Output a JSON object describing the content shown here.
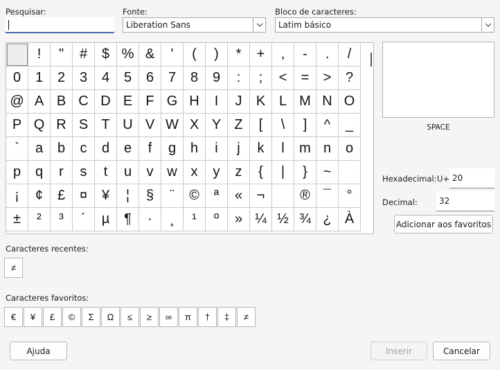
{
  "labels": {
    "search": "Pesquisar:",
    "font": "Fonte:",
    "block": "Bloco de caracteres:",
    "recent": "Caracteres recentes:",
    "favorites": "Caracteres favoritos:",
    "hex": "Hexadecimal:",
    "hex_prefix": "U+",
    "decimal": "Decimal:"
  },
  "search": {
    "value": ""
  },
  "font": {
    "value": "Liberation Sans"
  },
  "block": {
    "value": "Latim básico"
  },
  "grid": {
    "chars": [
      "",
      "!",
      "\"",
      "#",
      "$",
      "%",
      "&",
      "'",
      "(",
      ")",
      "*",
      "+",
      ",",
      "-",
      ".",
      "/",
      "0",
      "1",
      "2",
      "3",
      "4",
      "5",
      "6",
      "7",
      "8",
      "9",
      ":",
      ";",
      "<",
      "=",
      ">",
      "?",
      "@",
      "A",
      "B",
      "C",
      "D",
      "E",
      "F",
      "G",
      "H",
      "I",
      "J",
      "K",
      "L",
      "M",
      "N",
      "O",
      "P",
      "Q",
      "R",
      "S",
      "T",
      "U",
      "V",
      "W",
      "X",
      "Y",
      "Z",
      "[",
      "\\",
      "]",
      "^",
      "_",
      "`",
      "a",
      "b",
      "c",
      "d",
      "e",
      "f",
      "g",
      "h",
      "i",
      "j",
      "k",
      "l",
      "m",
      "n",
      "o",
      "p",
      "q",
      "r",
      "s",
      "t",
      "u",
      "v",
      "w",
      "x",
      "y",
      "z",
      "{",
      "|",
      "}",
      "~",
      "",
      "¡",
      "¢",
      "£",
      "¤",
      "¥",
      "¦",
      "§",
      "¨",
      "©",
      "ª",
      "«",
      "¬",
      "",
      "®",
      "¯",
      "°",
      "±",
      "²",
      "³",
      "´",
      "µ",
      "¶",
      "·",
      "¸",
      "¹",
      "º",
      "»",
      "¼",
      "½",
      "¾",
      "¿",
      "À"
    ],
    "selected_index": 0
  },
  "preview": {
    "char_name": "SPACE"
  },
  "hex_value": "20",
  "decimal_value": "32",
  "buttons": {
    "add_favorite": "Adicionar aos favoritos",
    "help": "Ajuda",
    "insert": "Inserir",
    "cancel": "Cancelar"
  },
  "recent_chars": [
    "≠"
  ],
  "favorite_chars": [
    "€",
    "¥",
    "£",
    "©",
    "Σ",
    "Ω",
    "≤",
    "≥",
    "∞",
    "π",
    "†",
    "‡",
    "≠"
  ]
}
